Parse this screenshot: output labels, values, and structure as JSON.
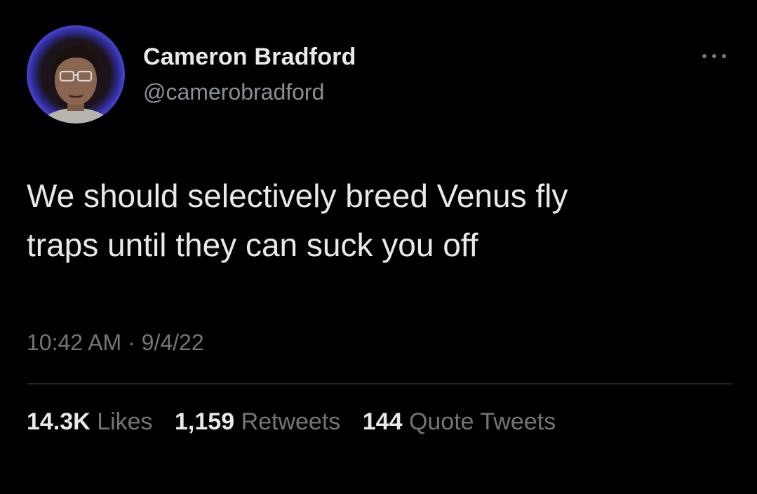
{
  "tweet": {
    "author": {
      "name": "Cameron Bradford",
      "handle": "@camerobradford"
    },
    "more_icon": "more-dots-icon",
    "text_lines": [
      "We should selectively breed Venus fly",
      "traps until they can suck you off"
    ],
    "timestamp": "10:42 AM · 9/4/22",
    "stats": {
      "likes_value": "14.3K",
      "likes_label": "Likes",
      "retweets_value": "1,159",
      "retweets_label": "Retweets",
      "quotes_value": "144",
      "quotes_label": "Quote Tweets"
    }
  },
  "colors": {
    "background": "#000000",
    "primary_text": "#e7e9ea",
    "secondary_text": "#71767b",
    "divider": "#1f2327"
  }
}
